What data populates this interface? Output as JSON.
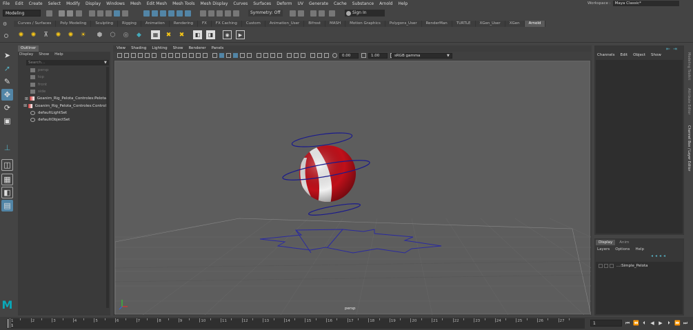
{
  "menubar": [
    "File",
    "Edit",
    "Create",
    "Select",
    "Modify",
    "Display",
    "Windows",
    "Mesh",
    "Edit Mesh",
    "Mesh Tools",
    "Mesh Display",
    "Curves",
    "Surfaces",
    "Deform",
    "UV",
    "Generate",
    "Cache",
    "Substance",
    "Arnold",
    "Help"
  ],
  "workspace": {
    "label": "Workspace :",
    "value": "Maya Classic*"
  },
  "statusline": {
    "mode": "Modeling",
    "symmetry": "Symmetry: Off",
    "signin": "Sign In"
  },
  "shelf_tabs": [
    "Curves / Surfaces",
    "Poly Modeling",
    "Sculpting",
    "Rigging",
    "Animation",
    "Rendering",
    "FX",
    "FX Caching",
    "Custom",
    "Animation_User",
    "Bifrost",
    "MASH",
    "Motion Graphics",
    "Polygons_User",
    "RenderMan",
    "TURTLE",
    "XGen_User",
    "XGen",
    "Arnold"
  ],
  "active_shelf": "Arnold",
  "outliner": {
    "title": "Outliner",
    "menu": [
      "Display",
      "Show",
      "Help"
    ],
    "search_placeholder": "Search...",
    "items": [
      {
        "label": "persp",
        "dim": true,
        "type": "camera"
      },
      {
        "label": "top",
        "dim": true,
        "type": "camera"
      },
      {
        "label": "front",
        "dim": true,
        "type": "camera"
      },
      {
        "label": "side",
        "dim": true,
        "type": "camera"
      },
      {
        "label": "Goanim_Rig_Pelota_Controles:Pelota",
        "dim": false,
        "type": "rig"
      },
      {
        "label": "Goanim_Rig_Pelota_Controles:Control",
        "dim": false,
        "type": "rig"
      },
      {
        "label": "defaultLightSet",
        "dim": false,
        "type": "set"
      },
      {
        "label": "defaultObjectSet",
        "dim": false,
        "type": "set"
      }
    ]
  },
  "viewport": {
    "menu": [
      "View",
      "Shading",
      "Lighting",
      "Show",
      "Renderer",
      "Panels"
    ],
    "exposure": "0.00",
    "gamma": "1.00",
    "colorspace": "sRGB gamma",
    "camera_label": "persp"
  },
  "channelbox": {
    "menu": [
      "Channels",
      "Edit",
      "Object",
      "Show"
    ]
  },
  "layer_editor": {
    "tabs": [
      "Display",
      "Anim"
    ],
    "menu": [
      "Layers",
      "Options",
      "Help"
    ],
    "layer_name": "...:Simple_Pelota"
  },
  "right_tabs": [
    "Modeling Toolkit",
    "Attribute Editor",
    "Channel Box / Layer Editor"
  ],
  "timeline": {
    "ticks": [
      "1",
      "2",
      "3",
      "4",
      "5",
      "6",
      "7",
      "8",
      "9",
      "10",
      "11",
      "12",
      "13",
      "14",
      "15",
      "16",
      "17",
      "18",
      "19",
      "20",
      "21",
      "22",
      "23",
      "24",
      "25",
      "26",
      "27"
    ],
    "current_frame": "1",
    "frame_field": "1"
  },
  "colors": {
    "accent": "#5285a6",
    "ball_red": "#c0101a",
    "ball_white": "#f0f0f0",
    "curve": "#1a1a8c",
    "logo": "#0aa8b8"
  }
}
